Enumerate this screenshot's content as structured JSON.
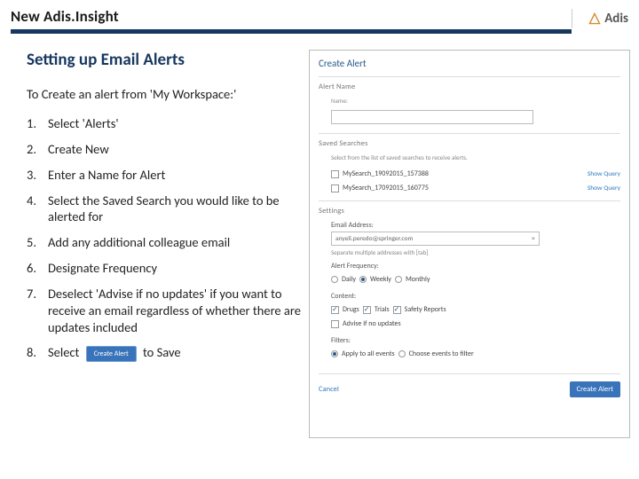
{
  "header": {
    "title": "New Adis.Insight",
    "logo_text": "Adis"
  },
  "left": {
    "section_title": "Setting up Email Alerts",
    "intro": "To Create an alert from 'My Workspace:'",
    "steps": [
      "Select 'Alerts'",
      "Create New",
      "Enter a Name for Alert",
      "Select the Saved Search you would like to be alerted for",
      "Add any additional colleague email",
      "Designate Frequency",
      "Deselect 'Advise if no updates' if you want to receive an email regardless of whether there are updates included"
    ],
    "step8_prefix": "Select",
    "step8_button": "Create Alert",
    "step8_suffix": "to Save"
  },
  "dialog": {
    "title": "Create Alert",
    "sec_alert_name": "Alert Name",
    "name_label": "Name:",
    "sec_saved": "Saved Searches",
    "saved_desc": "Select from the list of saved searches to receive alerts.",
    "saved_items": [
      "MySearch_19092015_157388",
      "MySearch_17092015_160775"
    ],
    "show_query": "Show Query",
    "sec_settings": "Settings",
    "email_label": "Email Address:",
    "email_value": "anyeli.peredo@springer.com",
    "email_hint": "Separate multiple addresses with [tab]",
    "freq_label": "Alert Frequency:",
    "freq_options": [
      "Daily",
      "Weekly",
      "Monthly"
    ],
    "content_label": "Content:",
    "content_options": [
      "Drugs",
      "Trials",
      "Safety Reports"
    ],
    "advise_label": "Advise if no updates",
    "filters_label": "Filters:",
    "filter_opt_all": "Apply to all events",
    "filter_opt_choose": "Choose events to filter",
    "cancel": "Cancel",
    "create": "Create Alert"
  }
}
